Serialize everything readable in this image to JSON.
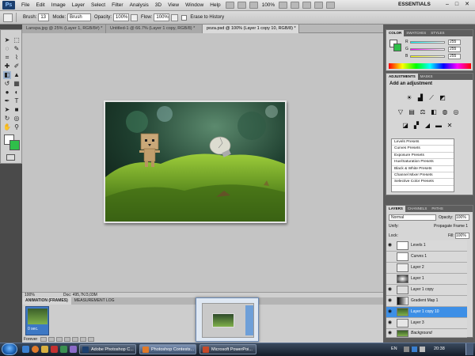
{
  "app": {
    "logo": "Ps"
  },
  "menu": {
    "items": [
      "File",
      "Edit",
      "Image",
      "Layer",
      "Select",
      "Filter",
      "Analysis",
      "3D",
      "View",
      "Window",
      "Help"
    ],
    "zoom": "100%",
    "workspace": "ESSENTIALS",
    "minimize": "–",
    "maximize": "□",
    "close": "✕"
  },
  "options": {
    "brush_label": "Brush:",
    "brush_size": "13",
    "mode_label": "Mode:",
    "mode_value": "Brush",
    "opacity_label": "Opacity:",
    "opacity_value": "100%",
    "flow_label": "Flow:",
    "flow_value": "100%",
    "erase_history_label": "Erase to History"
  },
  "tabs": [
    {
      "label": "Lanspa.jpg @ 25% (Layer 1, RGB/8#) *"
    },
    {
      "label": "Untitled-1 @ 66.7% (Layer 1 copy, RGB/8) *"
    },
    {
      "label": "poza.psd @ 100% (Layer 1 copy 10, RGB/8) *"
    }
  ],
  "status": {
    "zoom": "100%",
    "doc": "Doc: 495,7K/3,03M"
  },
  "animation": {
    "tab_frames": "ANIMATION (FRAMES)",
    "tab_measurement": "MEASUREMENT LOG",
    "frame_number": "1",
    "frame_delay": "0 sec.",
    "loop": "Forever"
  },
  "color_panel": {
    "tabs": [
      "COLOR",
      "SWATCHES",
      "STYLES"
    ],
    "r": "255",
    "g": "255",
    "b": "255",
    "r_label": "R",
    "g_label": "G",
    "b_label": "B"
  },
  "adjustments": {
    "tabs": [
      "ADJUSTMENTS",
      "MASKS"
    ],
    "title": "Add an adjustment",
    "presets": [
      "Levels Presets",
      "Curves Presets",
      "Exposure Presets",
      "Hue/Saturation Presets",
      "Black & White Presets",
      "Channel Mixer Presets",
      "Selective Color Presets"
    ]
  },
  "layers": {
    "tabs": [
      "LAYERS",
      "CHANNELS",
      "PATHS"
    ],
    "blend_mode": "Normal",
    "opacity_label": "Opacity:",
    "opacity_value": "100%",
    "unify_label": "Unify:",
    "propagate_label": "Propagate Frame 1",
    "lock_label": "Lock:",
    "fill_label": "Fill:",
    "fill_value": "100%",
    "rows": [
      {
        "name": "Levels 1",
        "visible": true
      },
      {
        "name": "Curves 1",
        "visible": false
      },
      {
        "name": "Layer 2",
        "visible": false
      },
      {
        "name": "Layer 1",
        "visible": false
      },
      {
        "name": "Layer 1 copy",
        "visible": true
      },
      {
        "name": "Gradient Map 1",
        "visible": true
      },
      {
        "name": "Layer 1 copy 10",
        "visible": true,
        "selected": true
      },
      {
        "name": "Layer 3",
        "visible": true
      },
      {
        "name": "Background",
        "visible": true
      }
    ]
  },
  "taskbar": {
    "buttons": [
      {
        "label": "Adobe Photoshop C...",
        "icon_color": "#1c3f6e"
      },
      {
        "label": "Photoshop Contests...",
        "icon_color": "#e07a2a"
      },
      {
        "label": "Microsoft PowerPoi...",
        "icon_color": "#c44a2a"
      }
    ],
    "lang": "EN",
    "time": "20:38"
  },
  "colors": {
    "foreground": "#ffffff",
    "background": "#2fbf4a",
    "selection": "#3d8fe6"
  }
}
